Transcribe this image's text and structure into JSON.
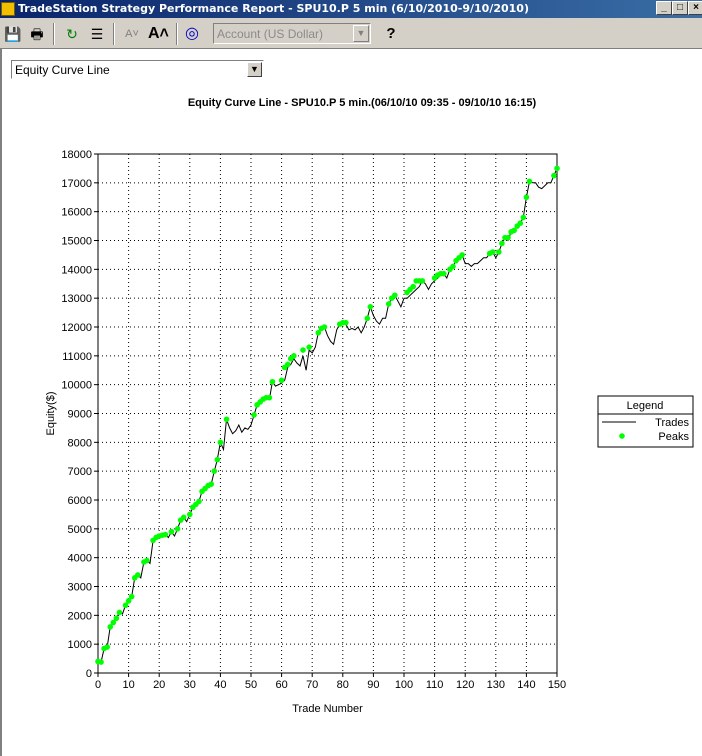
{
  "window": {
    "title": "TradeStation Strategy Performance Report - SPU10.P 5 min (6/10/2010-9/10/2010)"
  },
  "toolbar": {
    "buttons": [
      "save-icon",
      "print-icon",
      "refresh-icon",
      "properties-icon",
      "font-decrease-icon",
      "font-increase-icon",
      "target-icon",
      "help-icon"
    ],
    "account_value": "Account (US Dollar)"
  },
  "report_selector": {
    "value": "Equity Curve Line"
  },
  "colors": {
    "trades_line": "#000000",
    "peaks": "#00ff00",
    "grid": "#000000"
  },
  "chart_data": {
    "type": "line",
    "title": "Equity Curve Line - SPU10.P 5 min.(06/10/10 09:35 - 09/10/10 16:15)",
    "xlabel": "Trade Number",
    "ylabel": "Equity($)",
    "xlim": [
      0,
      150
    ],
    "ylim": [
      0,
      18000
    ],
    "xticks": [
      0,
      10,
      20,
      30,
      40,
      50,
      60,
      70,
      80,
      90,
      100,
      110,
      120,
      130,
      140,
      150
    ],
    "yticks": [
      0,
      1000,
      2000,
      3000,
      4000,
      5000,
      6000,
      7000,
      8000,
      9000,
      10000,
      11000,
      12000,
      13000,
      14000,
      15000,
      16000,
      17000,
      18000
    ],
    "grid": true,
    "legend": {
      "title": "Legend",
      "position": "right",
      "entries": [
        "Trades",
        "Peaks"
      ]
    },
    "series": [
      {
        "name": "Trades",
        "x": [
          0,
          1,
          2,
          3,
          4,
          5,
          6,
          7,
          8,
          9,
          10,
          11,
          12,
          13,
          14,
          15,
          16,
          17,
          18,
          19,
          20,
          21,
          22,
          23,
          24,
          25,
          26,
          27,
          28,
          29,
          30,
          31,
          32,
          33,
          34,
          35,
          36,
          37,
          38,
          39,
          40,
          41,
          42,
          43,
          44,
          45,
          46,
          47,
          48,
          49,
          50,
          51,
          52,
          53,
          54,
          55,
          56,
          57,
          58,
          59,
          60,
          61,
          62,
          63,
          64,
          65,
          66,
          67,
          68,
          69,
          70,
          71,
          72,
          73,
          74,
          75,
          76,
          77,
          78,
          79,
          80,
          81,
          82,
          83,
          84,
          85,
          86,
          87,
          88,
          89,
          90,
          91,
          92,
          93,
          94,
          95,
          96,
          97,
          98,
          99,
          100,
          101,
          102,
          103,
          104,
          105,
          106,
          107,
          108,
          109,
          110,
          111,
          112,
          113,
          114,
          115,
          116,
          117,
          118,
          119,
          120,
          121,
          122,
          123,
          124,
          125,
          126,
          127,
          128,
          129,
          130,
          131,
          132,
          133,
          134,
          135,
          136,
          137,
          138,
          139,
          140,
          141,
          142,
          143,
          144,
          145,
          146,
          147,
          148,
          149,
          150
        ],
        "values": [
          400,
          380,
          850,
          900,
          1600,
          1750,
          1900,
          2100,
          2050,
          2350,
          2500,
          2650,
          3300,
          3400,
          3300,
          3850,
          3900,
          3800,
          4600,
          4700,
          4750,
          4780,
          4800,
          4700,
          4900,
          4750,
          5000,
          5300,
          5400,
          5250,
          5500,
          5750,
          5850,
          5950,
          6300,
          6400,
          6500,
          6550,
          7000,
          7400,
          8000,
          7750,
          8800,
          8500,
          8300,
          8400,
          8600,
          8350,
          8500,
          8450,
          8600,
          8950,
          9300,
          9400,
          9500,
          9550,
          9500,
          10100,
          9950,
          10000,
          10050,
          10150,
          10600,
          10700,
          10900,
          10750,
          10650,
          11000,
          10500,
          11200,
          11100,
          11300,
          11800,
          11950,
          12000,
          11700,
          11500,
          11400,
          11900,
          12100,
          12150,
          12100,
          11900,
          11950,
          11900,
          12000,
          11800,
          12000,
          12300,
          12700,
          12400,
          12200,
          12100,
          12300,
          12300,
          12800,
          13000,
          13100,
          12900,
          12700,
          13000,
          13000,
          13100,
          13200,
          13300,
          13400,
          13600,
          13500,
          13300,
          13500,
          13600,
          13700,
          13800,
          13850,
          13700,
          14000,
          14100,
          14300,
          14400,
          14500,
          14200,
          14200,
          14100,
          14200,
          14200,
          14300,
          14400,
          14400,
          14550,
          14600,
          14400,
          14600,
          14900,
          15100,
          15000,
          15300,
          15350,
          15500,
          15600,
          15800,
          16500,
          17050,
          17000,
          17000,
          16850,
          16800,
          16900,
          17000,
          17000,
          17250,
          17500
        ]
      },
      {
        "name": "Peaks",
        "x": [
          0,
          1,
          2,
          3,
          4,
          5,
          6,
          7,
          9,
          10,
          11,
          12,
          13,
          15,
          16,
          18,
          19,
          20,
          21,
          22,
          24,
          26,
          27,
          28,
          30,
          31,
          32,
          33,
          34,
          35,
          36,
          37,
          38,
          39,
          40,
          42,
          51,
          52,
          53,
          54,
          55,
          56,
          57,
          60,
          61,
          62,
          63,
          64,
          67,
          69,
          72,
          73,
          74,
          79,
          80,
          81,
          88,
          89,
          95,
          96,
          97,
          101,
          102,
          103,
          104,
          105,
          106,
          110,
          111,
          112,
          113,
          115,
          116,
          117,
          118,
          119,
          128,
          129,
          131,
          132,
          133,
          134,
          135,
          136,
          137,
          138,
          139,
          140,
          141,
          149,
          150
        ],
        "values": [
          400,
          380,
          850,
          900,
          1600,
          1750,
          1900,
          2100,
          2350,
          2500,
          2650,
          3300,
          3400,
          3850,
          3900,
          4600,
          4700,
          4750,
          4780,
          4800,
          4900,
          5000,
          5300,
          5400,
          5500,
          5750,
          5850,
          5950,
          6300,
          6400,
          6500,
          6550,
          7000,
          7400,
          8000,
          8800,
          8950,
          9300,
          9400,
          9500,
          9550,
          9550,
          10100,
          10150,
          10600,
          10700,
          10900,
          11000,
          11200,
          11300,
          11800,
          11950,
          12000,
          12100,
          12150,
          12150,
          12300,
          12700,
          12800,
          13000,
          13100,
          13200,
          13300,
          13400,
          13600,
          13600,
          13600,
          13700,
          13800,
          13850,
          13850,
          14000,
          14100,
          14300,
          14400,
          14500,
          14550,
          14600,
          14600,
          14900,
          15100,
          15100,
          15300,
          15350,
          15500,
          15600,
          15800,
          16500,
          17050,
          17250,
          17500
        ]
      }
    ]
  }
}
